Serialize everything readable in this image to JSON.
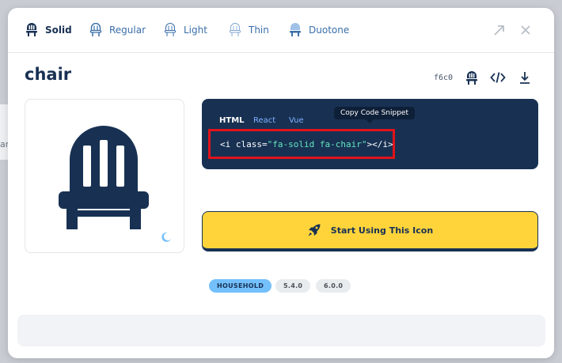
{
  "backdrop": {
    "fragment": "ar"
  },
  "style_tabs": [
    {
      "label": "Solid",
      "icon": "chair-solid-icon",
      "active": true
    },
    {
      "label": "Regular",
      "icon": "chair-regular-icon",
      "active": false
    },
    {
      "label": "Light",
      "icon": "chair-light-icon",
      "active": false
    },
    {
      "label": "Thin",
      "icon": "chair-thin-icon",
      "active": false
    },
    {
      "label": "Duotone",
      "icon": "chair-duotone-icon",
      "active": false
    }
  ],
  "header_actions": {
    "expand": "expand-icon",
    "close": "close-icon"
  },
  "icon": {
    "name": "chair",
    "unicode": "f6c0"
  },
  "actions": [
    "chair-glyph-icon",
    "code-icon",
    "download-icon"
  ],
  "code": {
    "tabs": [
      {
        "label": "HTML",
        "active": true
      },
      {
        "label": "React",
        "active": false
      },
      {
        "label": "Vue",
        "active": false
      }
    ],
    "tooltip": "Copy Code Snippet",
    "snippet_open": "<i class=",
    "snippet_class": "\"fa-solid fa-chair\"",
    "snippet_close": "></i>"
  },
  "cta": {
    "label": "Start Using This Icon",
    "icon": "rocket-icon"
  },
  "tags": {
    "category": "HOUSEHOLD",
    "versions": [
      "5.4.0",
      "6.0.0"
    ]
  },
  "colors": {
    "navy": "#183153",
    "yellow": "#ffd43b",
    "highlight": "#e0131b",
    "accent_blue": "#74c0fc"
  }
}
